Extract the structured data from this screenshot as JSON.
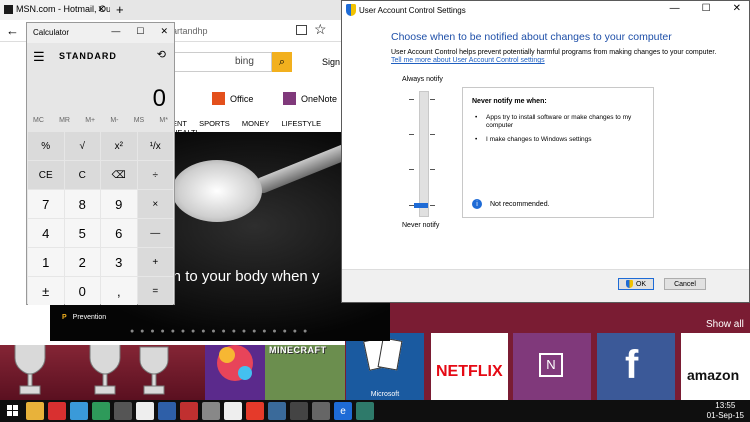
{
  "colors": {
    "accent": "#1e6bd6",
    "uac_heading": "#1e4fa8",
    "bing_search": "#f2b01e",
    "taskbar": "#0f0f0f",
    "start_bg": "#7a1c33"
  },
  "browser": {
    "tab_title": "MSN.com - Hotmail, Ou",
    "url_partial": "artandhp",
    "search_logo": "bing",
    "signin": "Sign i",
    "apps": [
      {
        "label": "Office",
        "icon": "office-icon"
      },
      {
        "label": "OneNote",
        "icon": "onenote-icon"
      }
    ],
    "nav": [
      "ENT",
      "SPORTS",
      "MONEY",
      "LIFESTYLE",
      "HEALTI"
    ],
    "hero": {
      "headline": "pen to your body when y",
      "source": "Prevention"
    }
  },
  "calculator": {
    "title": "Calculator",
    "mode": "STANDARD",
    "display": "0",
    "memory": [
      "MC",
      "MR",
      "M+",
      "M-",
      "MS",
      "M*"
    ],
    "keys": [
      "%",
      "√",
      "x²",
      "¹/x",
      "CE",
      "C",
      "⌫",
      "÷",
      "7",
      "8",
      "9",
      "×",
      "4",
      "5",
      "6",
      "—",
      "1",
      "2",
      "3",
      "+",
      "±",
      "0",
      ",",
      "="
    ]
  },
  "uac": {
    "title": "User Account Control Settings",
    "heading": "Choose when to be notified about changes to your computer",
    "description": "User Account Control helps prevent potentially harmful programs from making changes to your computer.",
    "link": "Tell me more about User Account Control settings",
    "label_top": "Always notify",
    "label_bottom": "Never notify",
    "slider_level": 0,
    "info_title": "Never notify me when:",
    "bullets": [
      "Apps try to install software or make changes to my computer",
      "I make changes to Windows settings"
    ],
    "note": "Not recommended.",
    "ok": "OK",
    "cancel": "Cancel"
  },
  "start": {
    "showall": "Show all",
    "tiles": [
      {
        "name": "trophy",
        "icon": "trophy-icon"
      },
      {
        "name": "candy-crush",
        "icon": "candy-icon"
      },
      {
        "name": "minecraft",
        "label": "MINECRAFT"
      },
      {
        "name": "solitaire",
        "label": "Microsoft"
      },
      {
        "name": "netflix",
        "label": "NETFLIX"
      },
      {
        "name": "onenote",
        "label": "N"
      },
      {
        "name": "facebook",
        "label": "f"
      },
      {
        "name": "amazon",
        "label": "amazon"
      }
    ]
  },
  "taskbar": {
    "icons": [
      "windows-icon",
      "explorer-icon",
      "app-icon",
      "app-icon",
      "app-icon",
      "app-icon",
      "app-icon",
      "app-icon",
      "app-icon",
      "app-icon",
      "app-icon",
      "app-icon",
      "app-icon",
      "app-icon",
      "store-icon",
      "calculator-icon",
      "edge-icon",
      "uac-icon"
    ],
    "time": "13:55",
    "date": "01-Sep-15"
  }
}
